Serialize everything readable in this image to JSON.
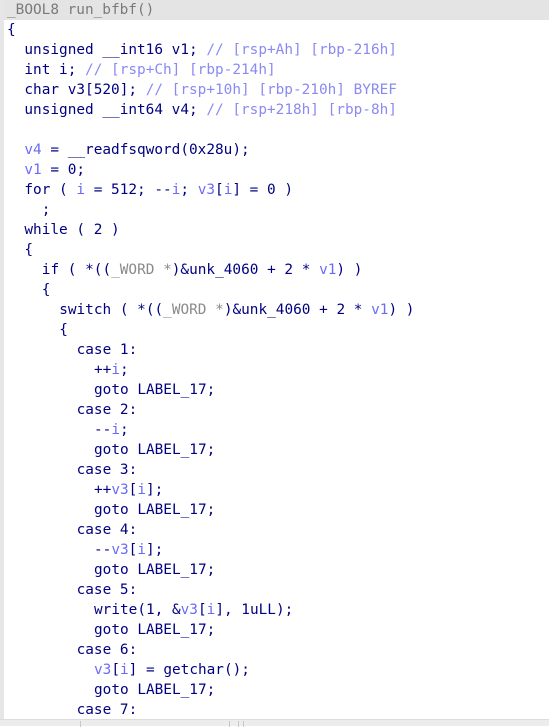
{
  "pseudocode": {
    "lines": [
      {
        "indent": 0,
        "current": true,
        "tokens": [
          [
            "h",
            "_BOOL8 run_bfbf()"
          ]
        ]
      },
      {
        "indent": 0,
        "tokens": [
          [
            "k",
            "{"
          ]
        ]
      },
      {
        "indent": 1,
        "tokens": [
          [
            "k",
            "unsigned __int16 v1; "
          ],
          [
            "c",
            "// [rsp+Ah] [rbp-216h]"
          ]
        ]
      },
      {
        "indent": 1,
        "tokens": [
          [
            "k",
            "int i; "
          ],
          [
            "c",
            "// [rsp+Ch] [rbp-214h]"
          ]
        ]
      },
      {
        "indent": 1,
        "tokens": [
          [
            "k",
            "char v3[520]; "
          ],
          [
            "c",
            "// [rsp+10h] [rbp-210h] BYREF"
          ]
        ]
      },
      {
        "indent": 1,
        "tokens": [
          [
            "k",
            "unsigned __int64 v4; "
          ],
          [
            "c",
            "// [rsp+218h] [rbp-8h]"
          ]
        ]
      },
      {
        "indent": 0,
        "tokens": []
      },
      {
        "indent": 1,
        "tokens": [
          [
            "v",
            "v4"
          ],
          [
            "k",
            " = __readfsqword(0x28u);"
          ]
        ]
      },
      {
        "indent": 1,
        "tokens": [
          [
            "v",
            "v1"
          ],
          [
            "k",
            " = 0;"
          ]
        ]
      },
      {
        "indent": 1,
        "tokens": [
          [
            "k",
            "for ( "
          ],
          [
            "v",
            "i"
          ],
          [
            "k",
            " = 512; --"
          ],
          [
            "v",
            "i"
          ],
          [
            "k",
            "; "
          ],
          [
            "v",
            "v3"
          ],
          [
            "k",
            "["
          ],
          [
            "v",
            "i"
          ],
          [
            "k",
            "] = 0 )"
          ]
        ]
      },
      {
        "indent": 2,
        "tokens": [
          [
            "k",
            ";"
          ]
        ]
      },
      {
        "indent": 1,
        "tokens": [
          [
            "k",
            "while ( 2 )"
          ]
        ]
      },
      {
        "indent": 1,
        "tokens": [
          [
            "k",
            "{"
          ]
        ]
      },
      {
        "indent": 2,
        "tokens": [
          [
            "k",
            "if ( *(("
          ],
          [
            "g",
            "_WORD *"
          ],
          [
            "k",
            ")&unk_4060 + 2 * "
          ],
          [
            "v",
            "v1"
          ],
          [
            "k",
            ") )"
          ]
        ]
      },
      {
        "indent": 2,
        "tokens": [
          [
            "k",
            "{"
          ]
        ]
      },
      {
        "indent": 3,
        "tokens": [
          [
            "k",
            "switch ( *(("
          ],
          [
            "g",
            "_WORD *"
          ],
          [
            "k",
            ")&unk_4060 + 2 * "
          ],
          [
            "v",
            "v1"
          ],
          [
            "k",
            ") )"
          ]
        ]
      },
      {
        "indent": 3,
        "tokens": [
          [
            "k",
            "{"
          ]
        ]
      },
      {
        "indent": 4,
        "tokens": [
          [
            "k",
            "case 1:"
          ]
        ]
      },
      {
        "indent": 5,
        "tokens": [
          [
            "k",
            "++"
          ],
          [
            "v",
            "i"
          ],
          [
            "k",
            ";"
          ]
        ]
      },
      {
        "indent": 5,
        "tokens": [
          [
            "k",
            "goto LABEL_17;"
          ]
        ]
      },
      {
        "indent": 4,
        "tokens": [
          [
            "k",
            "case 2:"
          ]
        ]
      },
      {
        "indent": 5,
        "tokens": [
          [
            "k",
            "--"
          ],
          [
            "v",
            "i"
          ],
          [
            "k",
            ";"
          ]
        ]
      },
      {
        "indent": 5,
        "tokens": [
          [
            "k",
            "goto LABEL_17;"
          ]
        ]
      },
      {
        "indent": 4,
        "tokens": [
          [
            "k",
            "case 3:"
          ]
        ]
      },
      {
        "indent": 5,
        "tokens": [
          [
            "k",
            "++"
          ],
          [
            "v",
            "v3"
          ],
          [
            "k",
            "["
          ],
          [
            "v",
            "i"
          ],
          [
            "k",
            "];"
          ]
        ]
      },
      {
        "indent": 5,
        "tokens": [
          [
            "k",
            "goto LABEL_17;"
          ]
        ]
      },
      {
        "indent": 4,
        "tokens": [
          [
            "k",
            "case 4:"
          ]
        ]
      },
      {
        "indent": 5,
        "tokens": [
          [
            "k",
            "--"
          ],
          [
            "v",
            "v3"
          ],
          [
            "k",
            "["
          ],
          [
            "v",
            "i"
          ],
          [
            "k",
            "];"
          ]
        ]
      },
      {
        "indent": 5,
        "tokens": [
          [
            "k",
            "goto LABEL_17;"
          ]
        ]
      },
      {
        "indent": 4,
        "tokens": [
          [
            "k",
            "case 5:"
          ]
        ]
      },
      {
        "indent": 5,
        "tokens": [
          [
            "k",
            "write(1, &"
          ],
          [
            "v",
            "v3"
          ],
          [
            "k",
            "["
          ],
          [
            "v",
            "i"
          ],
          [
            "k",
            "], 1uLL);"
          ]
        ]
      },
      {
        "indent": 5,
        "tokens": [
          [
            "k",
            "goto LABEL_17;"
          ]
        ]
      },
      {
        "indent": 4,
        "tokens": [
          [
            "k",
            "case 6:"
          ]
        ]
      },
      {
        "indent": 5,
        "tokens": [
          [
            "v",
            "v3"
          ],
          [
            "k",
            "["
          ],
          [
            "v",
            "i"
          ],
          [
            "k",
            "] = getchar();"
          ]
        ]
      },
      {
        "indent": 5,
        "tokens": [
          [
            "k",
            "goto LABEL_17;"
          ]
        ]
      },
      {
        "indent": 4,
        "tokens": [
          [
            "k",
            "case 7:"
          ]
        ]
      }
    ]
  },
  "colors": {
    "keyword": "#000080",
    "variable": "#6b6bf5",
    "comment": "#8a8af2",
    "type_cast": "#8a8a8a",
    "current_line_bg": "#e4e4e4"
  }
}
